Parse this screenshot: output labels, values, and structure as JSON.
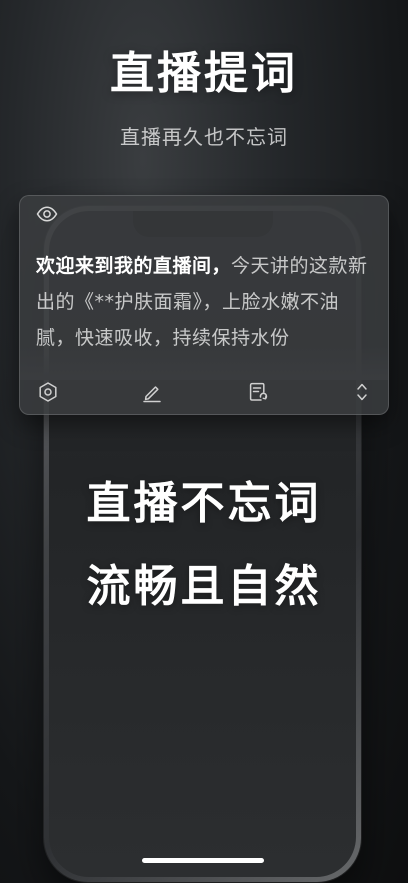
{
  "header": {
    "title": "直播提词",
    "subtitle": "直播再久也不忘词"
  },
  "prompter": {
    "spoken_text": "欢迎来到我的直播间，",
    "remaining_text": "今天讲的这款新出的《**护肤面霜》，上脸水嫩不油腻，快速吸收，持续保持水份",
    "icons": {
      "visibility": "eye-icon",
      "settings": "hexagon-settings-icon",
      "edit": "pencil-icon",
      "script": "script-document-icon",
      "resize": "resize-vertical-icon"
    }
  },
  "screen": {
    "slogan_line1": "直播不忘词",
    "slogan_line2": "流畅且自然"
  }
}
